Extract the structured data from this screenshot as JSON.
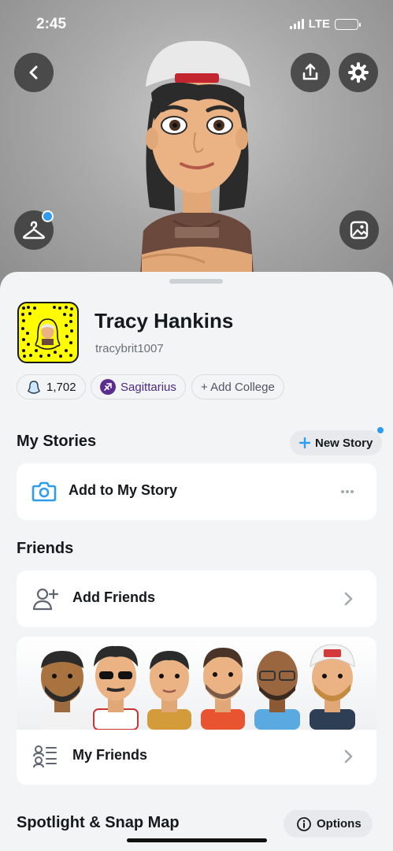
{
  "status_bar": {
    "time": "2:45",
    "network": "LTE"
  },
  "profile": {
    "display_name": "Tracy Hankins",
    "username": "tracybrit1007",
    "chips": {
      "score": "1,702",
      "zodiac": "Sagittarius",
      "add_college": "+ Add College"
    }
  },
  "my_stories": {
    "title": "My Stories",
    "new_story_label": "New Story",
    "add_story_label": "Add to My Story"
  },
  "friends": {
    "title": "Friends",
    "add_friends_label": "Add Friends",
    "my_friends_label": "My Friends"
  },
  "spotlight": {
    "title": "Spotlight & Snap Map",
    "options_label": "Options"
  },
  "icons": [
    "back-icon",
    "share-icon",
    "settings-icon",
    "hanger-icon",
    "photo-icon",
    "ghost-icon",
    "zodiac-icon",
    "camera-icon",
    "more-icon",
    "add-friend-icon",
    "chevron-right-icon",
    "friends-list-icon",
    "info-icon",
    "plus-icon"
  ],
  "colors": {
    "snapcode_yellow": "#fffc00",
    "accent_blue": "#2d9cf1",
    "zodiac_purple": "#5b2d8e"
  }
}
